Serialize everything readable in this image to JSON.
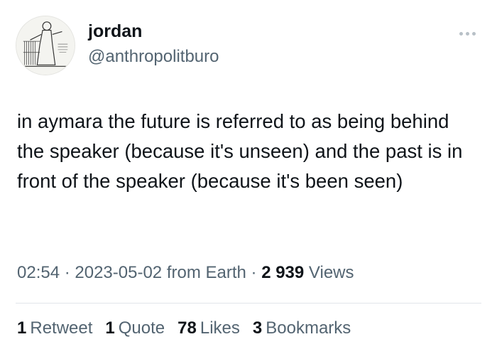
{
  "user": {
    "display_name": "jordan",
    "handle": "@anthropolitburo",
    "avatar_icon": "engraving-woman-weaving-avatar"
  },
  "tweet": {
    "text": "in aymara the future is referred to as being behind the speaker (because it's unseen) and the past is in front of the speaker (because it's been seen)"
  },
  "meta": {
    "time": "02:54",
    "sep1": " · ",
    "date": "2023-05-02",
    "source": " from Earth",
    "sep2": " · ",
    "views_count": "2 939",
    "views_label": " Views"
  },
  "stats": {
    "retweets": {
      "count": "1",
      "label": "Retweet"
    },
    "quotes": {
      "count": "1",
      "label": "Quote"
    },
    "likes": {
      "count": "78",
      "label": "Likes"
    },
    "bookmarks": {
      "count": "3",
      "label": "Bookmarks"
    }
  },
  "colors": {
    "text": "#0f1419",
    "secondary": "#536471",
    "divider": "#e1e6ea"
  }
}
